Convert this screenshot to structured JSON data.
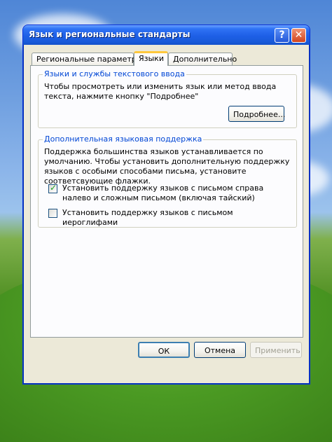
{
  "window": {
    "title": "Язык и региональные стандарты",
    "help_label": "?",
    "close_label": "✕"
  },
  "tabs": [
    {
      "label": "Региональные параметры",
      "active": false
    },
    {
      "label": "Языки",
      "active": true
    },
    {
      "label": "Дополнительно",
      "active": false
    }
  ],
  "text_services": {
    "title": "Языки и службы текстового ввода",
    "description": "Чтобы просмотреть или изменить язык или метод ввода текста, нажмите кнопку \"Подробнее\"",
    "details_button": "Подробнее..."
  },
  "supplemental": {
    "title": "Дополнительная языковая поддержка",
    "description": "Поддержка большинства языков устанавливается по умолчанию. Чтобы установить дополнительную поддержку языков с особыми способами письма, установите соответсвующие флажки.",
    "options": [
      {
        "label": "Установить поддержку языков с письмом справа налево и сложным письмом (включая тайский)",
        "checked": true
      },
      {
        "label": "Установить поддержку языков с письмом иероглифами",
        "checked": false
      }
    ]
  },
  "footer": {
    "ok": "ОК",
    "cancel": "Отмена",
    "apply": "Применить"
  }
}
